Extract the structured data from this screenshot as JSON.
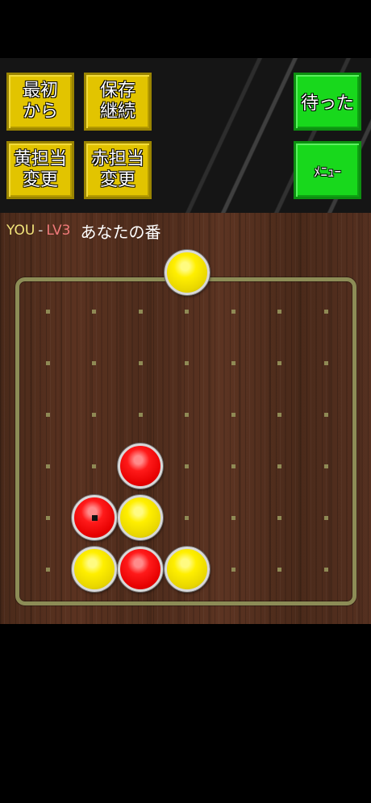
{
  "toolbar": {
    "buttons": [
      {
        "label": "最初\nから"
      },
      {
        "label": "保存\n継続"
      },
      {
        "label": "黄担当\n変更"
      },
      {
        "label": "赤担当\n変更"
      }
    ],
    "undo_label": "待った",
    "menu_label": "ﾒﾆｭｰ"
  },
  "status": {
    "player": "YOU",
    "separator": "-",
    "level": "LV3",
    "turn_text": "あなたの番"
  },
  "game": {
    "columns": 7,
    "rows": 6,
    "next_disc": {
      "color": "yellow",
      "column": 4
    },
    "pieces": [
      {
        "color": "red",
        "column": 3,
        "row": 3,
        "last_move": false
      },
      {
        "color": "red",
        "column": 2,
        "row": 2,
        "last_move": true
      },
      {
        "color": "yellow",
        "column": 3,
        "row": 2,
        "last_move": false
      },
      {
        "color": "yellow",
        "column": 2,
        "row": 1,
        "last_move": false
      },
      {
        "color": "red",
        "column": 3,
        "row": 1,
        "last_move": false
      },
      {
        "color": "yellow",
        "column": 4,
        "row": 1,
        "last_move": false
      }
    ],
    "colors": {
      "yellow": "#ffef00",
      "red": "#ff1a1a",
      "board_frame": "#8c8c56",
      "undo_button": "#18d81c",
      "action_button": "#e2c400"
    }
  }
}
